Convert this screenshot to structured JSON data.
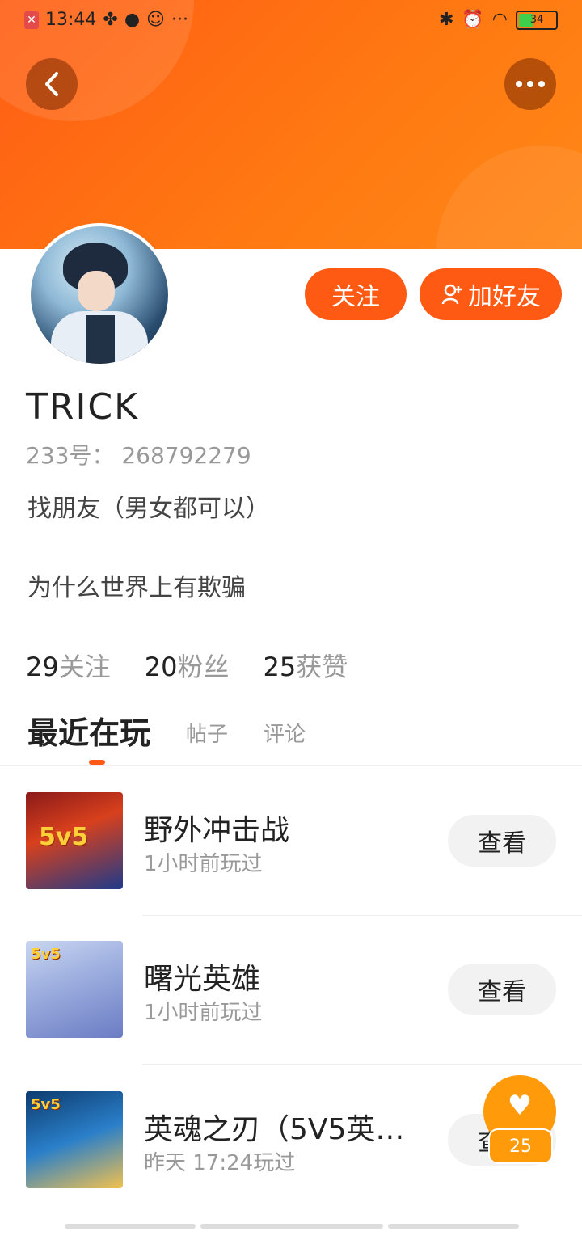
{
  "status_bar": {
    "time": "13:44",
    "battery": "34"
  },
  "profile": {
    "username": "TRICK",
    "uid_text": "233号： 268792279",
    "bio_line1": "找朋友（男女都可以）",
    "bio_line2": "为什么世界上有欺骗",
    "follow_label": "关注",
    "add_friend_label": "加好友"
  },
  "stats": [
    {
      "num": "29",
      "label": "关注"
    },
    {
      "num": "20",
      "label": "粉丝"
    },
    {
      "num": "25",
      "label": "获赞"
    }
  ],
  "tabs": [
    "最近在玩",
    "帖子",
    "评论"
  ],
  "games": [
    {
      "name": "野外冲击战",
      "time": "1小时前玩过",
      "button": "查看",
      "badge": "5v5"
    },
    {
      "name": "曙光英雄",
      "time": "1小时前玩过",
      "button": "查看",
      "badge": "5v5"
    },
    {
      "name": "英魂之刃（5V5英…",
      "time": "昨天 17:24玩过",
      "button": "查看",
      "badge": "5v5"
    }
  ],
  "like_count": "25",
  "colors": {
    "accent": "#ff5a14",
    "header": "#ff7a12",
    "fab": "#ff9a0a"
  }
}
